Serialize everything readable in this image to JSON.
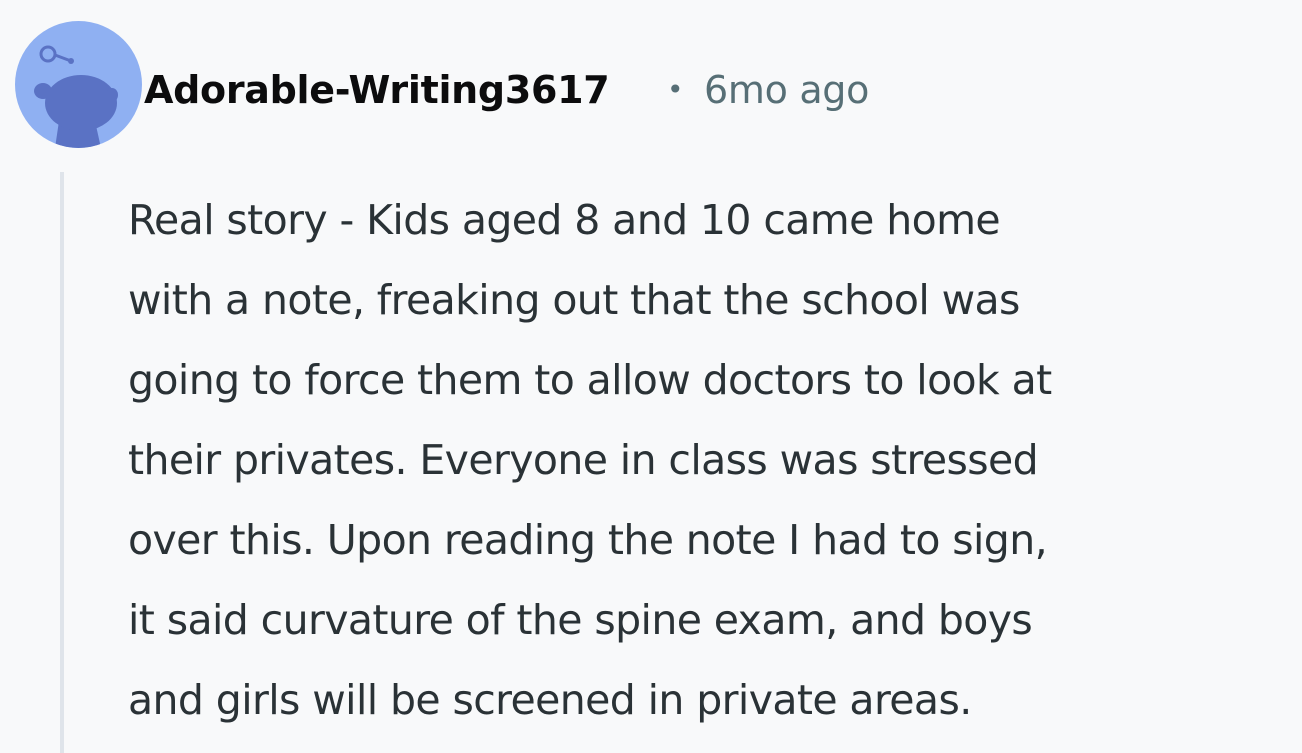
{
  "comment": {
    "author": "Adorable-Writing3617",
    "separator": "•",
    "timestamp": "6mo ago",
    "body_lines": [
      "Real story - Kids aged 8 and 10 came home",
      "with a note, freaking out that the school was",
      "going to force them to allow doctors to look at",
      "their privates. Everyone in class was stressed",
      "over this. Upon reading the note I had to sign,",
      "it said curvature of the spine exam, and boys",
      "and girls will be screened in private areas."
    ]
  },
  "colors": {
    "background": "#f8f9fa",
    "avatar_background": "#8fb0f2",
    "avatar_figure": "#5a72c4",
    "author_text": "#0c0c0d",
    "meta_text": "#576f76",
    "body_text": "#2a3236",
    "thread_line": "#dfe4ea"
  },
  "icons": {
    "avatar": "snoo-avatar-icon"
  }
}
